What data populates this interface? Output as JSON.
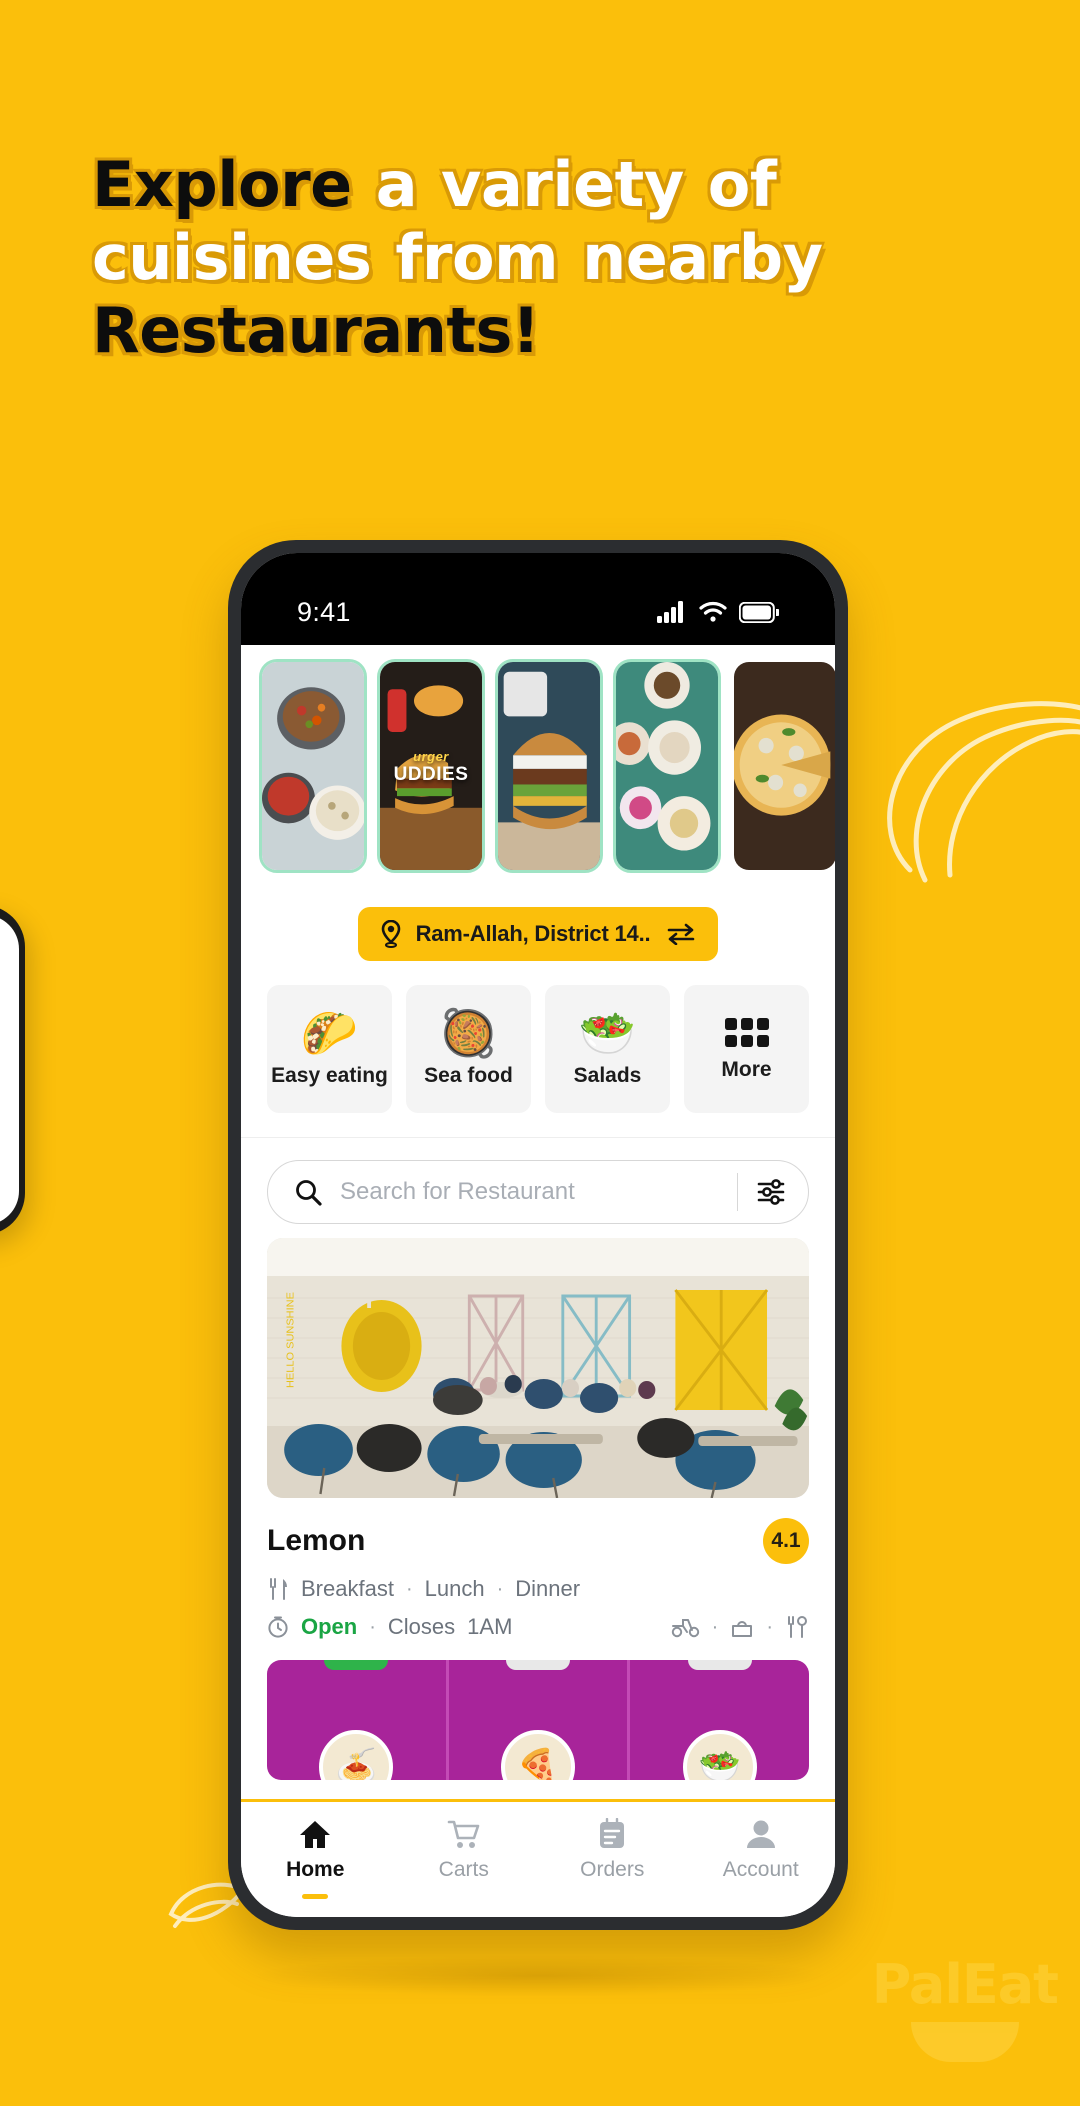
{
  "theme": {
    "brand_yellow": "#FBBF0B",
    "headline_shadow": "#D99A06",
    "accent_green": "#1aa544",
    "promo_purple": "#A8249A"
  },
  "headline": {
    "line1": [
      {
        "text": "Explore",
        "style": "dark"
      },
      {
        "text": "a",
        "style": "light"
      },
      {
        "text": "variety",
        "style": "light"
      },
      {
        "text": "of",
        "style": "light"
      }
    ],
    "line2": [
      {
        "text": "cuisines",
        "style": "light"
      },
      {
        "text": "from",
        "style": "light"
      },
      {
        "text": "nearby",
        "style": "light"
      }
    ],
    "line3": [
      {
        "text": "Restaurants!",
        "style": "dark"
      }
    ]
  },
  "statusbar": {
    "time": "9:41",
    "icons": [
      "cellular-signal-icon",
      "wifi-icon",
      "battery-icon"
    ]
  },
  "stories": [
    {
      "name": "story-skillet-dishes",
      "caption": "",
      "subcaption": ""
    },
    {
      "name": "story-burger-buddies",
      "caption": "UDDIES",
      "subcaption": "urger"
    },
    {
      "name": "story-big-burger",
      "caption": "",
      "subcaption": ""
    },
    {
      "name": "story-dessert-plates",
      "caption": "",
      "subcaption": ""
    },
    {
      "name": "story-pizza-board",
      "caption": "",
      "subcaption": ""
    }
  ],
  "location": {
    "pin_icon": "location-pin-icon",
    "text": "Ram-Allah, District 14..",
    "swap_icon": "swap-arrows-icon"
  },
  "categories": [
    {
      "label": "Easy eating",
      "icon": "taco-icon",
      "emoji": "🌮"
    },
    {
      "label": "Sea food",
      "icon": "shrimp-pan-icon",
      "emoji": "🥘"
    },
    {
      "label": "Salads",
      "icon": "salad-bowl-icon",
      "emoji": "🥗"
    },
    {
      "label": "More",
      "icon": "grid-more-icon",
      "emoji": ""
    }
  ],
  "search": {
    "placeholder": "Search for Restaurant",
    "search_icon": "search-icon",
    "filter_icon": "filter-sliders-icon"
  },
  "restaurant": {
    "name": "Lemon",
    "rating": "4.1",
    "meals_icon": "cutlery-icon",
    "meals": [
      "Breakfast",
      "Lunch",
      "Dinner"
    ],
    "hours_icon": "clock-icon",
    "status": "Open",
    "closes_label": "Closes",
    "closes_time": "1AM",
    "separator": "·",
    "services": [
      "delivery-scooter-icon",
      "takeout-bag-icon",
      "dine-in-icon"
    ],
    "photo_alt": "restaurant-interior-photo"
  },
  "promo": {
    "alt": "promo-menu-banner",
    "cells": [
      "🍝",
      "🍕",
      "🥗"
    ]
  },
  "bottomnav": [
    {
      "label": "Home",
      "icon": "home-icon",
      "active": true
    },
    {
      "label": "Carts",
      "icon": "cart-icon",
      "active": false
    },
    {
      "label": "Orders",
      "icon": "orders-clipboard-icon",
      "active": false
    },
    {
      "label": "Account",
      "icon": "account-person-icon",
      "active": false
    }
  ],
  "watermark": {
    "text": "PalEat"
  }
}
